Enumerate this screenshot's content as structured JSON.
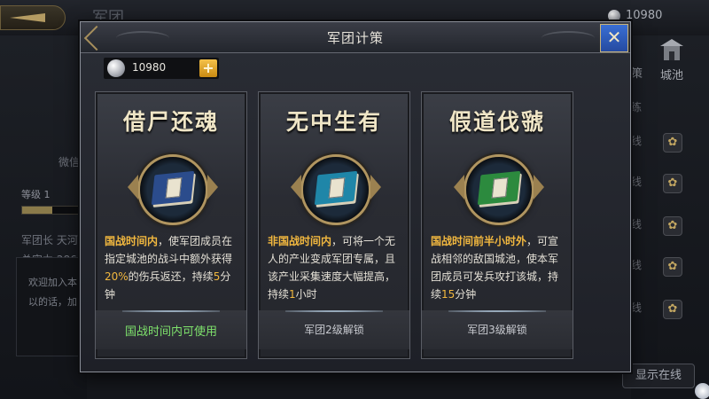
{
  "background": {
    "title": "军团",
    "currency_value": "10980",
    "left_panel": {
      "label_1": "微信",
      "level_label": "等级 1",
      "leader": "军团长 天河",
      "power": "总实力 286",
      "welcome_1": "欢迎加入本",
      "welcome_2": "以的话，加"
    },
    "right_panel": {
      "tab_strategy": "策",
      "tab_city": "城池",
      "rows": [
        "练",
        "线",
        "线",
        "线",
        "线",
        "线"
      ],
      "online_button": "显示在线"
    }
  },
  "dialog": {
    "title": "军团计策",
    "currency": {
      "icon": "silver-coin-icon",
      "value": "10980"
    },
    "close_icon": "close-x-icon",
    "cards": [
      {
        "title": "借尸还魂",
        "icon": "blue-tome-icon",
        "book_color": "#2b4c8c",
        "desc_highlight": "国战时间内",
        "desc_1": "，使军团成员在指定城池的战斗中额外获得",
        "desc_num_1": "20%",
        "desc_2": "的伤兵返还，持续",
        "desc_num_2": "5",
        "desc_3": "分钟",
        "footer": "国战时间内可使用",
        "footer_status": "usable"
      },
      {
        "title": "无中生有",
        "icon": "cyan-tome-icon",
        "book_color": "#1f86a8",
        "desc_highlight": "非国战时间内",
        "desc_1": "，可将一个无人的产业变成军团专属，且该产业采集速度大幅提高，持续",
        "desc_num_1": "1",
        "desc_2": "小时",
        "footer": "军团2级解锁",
        "footer_status": "locked"
      },
      {
        "title": "假道伐虢",
        "icon": "green-tome-icon",
        "book_color": "#2c8a3e",
        "desc_highlight": "国战时间前半小时外",
        "desc_1": "，可宣战相邻的敌国城池，使本军团成员可发兵攻打该城，持续",
        "desc_num_1": "15",
        "desc_2": "分钟",
        "footer": "军团3级解锁",
        "footer_status": "locked"
      }
    ]
  }
}
